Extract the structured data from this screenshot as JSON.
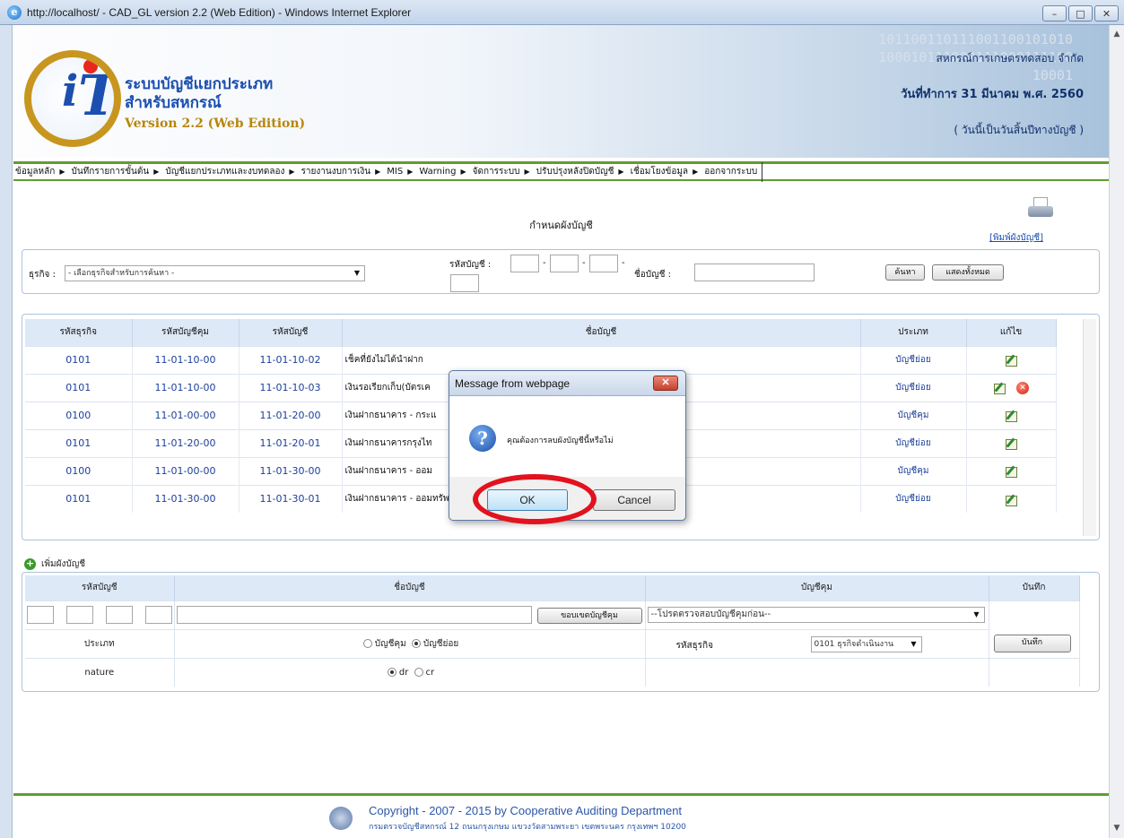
{
  "window": {
    "title": "http://localhost/ - CAD_GL version 2.2 (Web Edition) - Windows Internet Explorer",
    "controls": [
      "minimize",
      "maximize",
      "close"
    ]
  },
  "header": {
    "binary_decor": [
      "101100110111001100101010",
      "100010111000111000111100",
      "10001"
    ],
    "system_name_line1": "ระบบบัญชีแยกประเภท",
    "system_name_line2": "สำหรับสหกรณ์",
    "version": "Version 2.2 (Web Edition)",
    "cooperative": "สหกรณ์การเกษตรทดสอบ จำกัด",
    "operation_date": "วันที่ทำการ 31 มีนาคม พ.ศ. 2560",
    "year_end_note": "( วันนี้เป็นวันสิ้นปีทางบัญชี )"
  },
  "menu": [
    "ข้อมูลหลัก",
    "บันทึกรายการขั้นต้น",
    "บัญชีแยกประเภทและงบทดลอง",
    "รายงานงบการเงิน",
    "MIS",
    "Warning",
    "จัดการระบบ",
    "ปรับปรุงหลังปิดบัญชี",
    "เชื่อมโยงข้อมูล",
    "ออกจากระบบ"
  ],
  "page": {
    "title": "กำหนดผังบัญชี",
    "print_link": "[พิมพ์ผังบัญชี]"
  },
  "search": {
    "business_label": "ธุรกิจ :",
    "business_value": "- เลือกธุรกิจสำหรับการค้นหา -",
    "account_code_label": "รหัสบัญชี :",
    "account_name_label": "ชื่อบัญชี :",
    "search_button": "ค้นหา",
    "show_all_button": "แสดงทั้งหมด"
  },
  "grid": {
    "headers": [
      "รหัสธุรกิจ",
      "รหัสบัญชีคุม",
      "รหัสบัญชี",
      "ชื่อบัญชี",
      "ประเภท",
      "แก้ไข"
    ],
    "rows": [
      {
        "biz": "0101",
        "control": "11-01-10-00",
        "code": "11-01-10-02",
        "name": "เช็คที่ยังไม่ได้นำฝาก",
        "type": "บัญชีย่อย",
        "deletable": false
      },
      {
        "biz": "0101",
        "control": "11-01-10-00",
        "code": "11-01-10-03",
        "name": "เงินรอเรียกเก็บ(บัตรเค",
        "type": "บัญชีย่อย",
        "deletable": true
      },
      {
        "biz": "0100",
        "control": "11-01-00-00",
        "code": "11-01-20-00",
        "name": "เงินฝากธนาคาร - กระแ",
        "type": "บัญชีคุม",
        "deletable": false
      },
      {
        "biz": "0101",
        "control": "11-01-20-00",
        "code": "11-01-20-01",
        "name": "เงินฝากธนาคารกรุงไท",
        "type": "บัญชีย่อย",
        "deletable": false
      },
      {
        "biz": "0100",
        "control": "11-01-00-00",
        "code": "11-01-30-00",
        "name": "เงินฝากธนาคาร - ออม",
        "type": "บัญชีคุม",
        "deletable": false
      },
      {
        "biz": "0101",
        "control": "11-01-30-00",
        "code": "11-01-30-01",
        "name": "เงินฝากธนาคาร - ออมทรัพย์",
        "type": "บัญชีย่อย",
        "deletable": false
      }
    ]
  },
  "add_form": {
    "title": "เพิ่มผังบัญชี",
    "headers": [
      "รหัสบัญชี",
      "ชื่อบัญชี",
      "บัญชีคุม",
      "บันทึก"
    ],
    "check_control_button": "ขอบเขตบัญชีคุม",
    "control_select": "--โปรดตรวจสอบบัญชีคุมก่อน--",
    "type_label": "ประเภท",
    "type_control": "บัญชีคุม",
    "type_sub": "บัญชีย่อย",
    "type_selected": "บัญชีย่อย",
    "biz_label": "รหัสธุรกิจ",
    "biz_select": "0101 ธุรกิจดำเนินงาน",
    "save_button": "บันทึก",
    "nature_label": "nature",
    "nature_dr": "dr",
    "nature_cr": "cr",
    "nature_selected": "dr"
  },
  "footer": {
    "copyright": "Copyright - 2007 - 2015 by Cooperative Auditing Department",
    "address": "กรมตรวจบัญชีสหกรณ์ 12 ถนนกรุงเกษม แขวงวัดสามพระยา เขตพระนคร กรุงเทพฯ 10200"
  },
  "dialog": {
    "title": "Message from webpage",
    "message": "คุณต้องการลบผังบัญชีนี้หรือไม่",
    "ok": "OK",
    "cancel": "Cancel",
    "icon": "question-icon"
  },
  "annotation": {
    "color": "#e2121e",
    "target": "ok"
  }
}
